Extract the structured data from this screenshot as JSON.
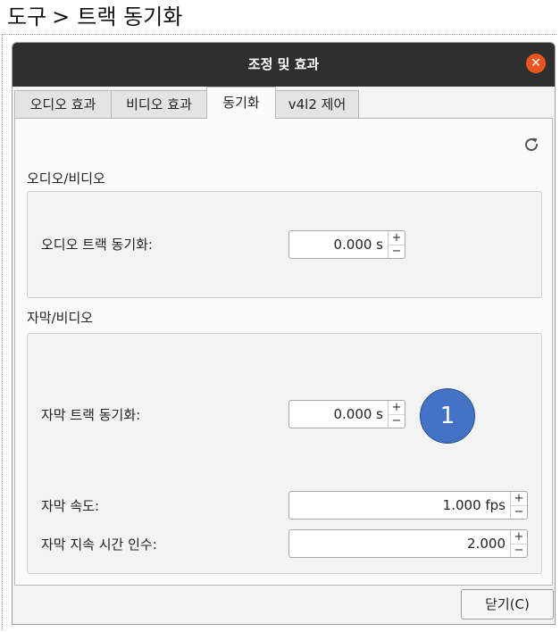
{
  "breadcrumb": {
    "part1": "도구",
    "separator": ">",
    "part2": "트랙 동기화"
  },
  "window": {
    "title": "조정 및 효과",
    "close_icon": "close-icon"
  },
  "tabs": [
    {
      "label": "오디오 효과"
    },
    {
      "label": "비디오 효과"
    },
    {
      "label": "동기화",
      "active": true
    },
    {
      "label": "v4l2 제어"
    }
  ],
  "sync": {
    "refresh_icon": "refresh-icon",
    "audio_video": {
      "section_label": "오디오/비디오",
      "audio_sync_label": "오디오 트랙 동기화:",
      "audio_sync_value": "0.000 s"
    },
    "subtitle_video": {
      "section_label": "자막/비디오",
      "subtitle_sync_label": "자막 트랙 동기화:",
      "subtitle_sync_value": "0.000 s",
      "subtitle_speed_label": "자막 속도:",
      "subtitle_speed_value": "1.000 fps",
      "subtitle_duration_label": "자막 지속 시간 인수:",
      "subtitle_duration_value": "2.000"
    }
  },
  "spin_up": "+",
  "spin_down": "−",
  "marker": {
    "label": "1",
    "color": "#4472c4"
  },
  "footer": {
    "close_button_label": "닫기(C)"
  },
  "colors": {
    "titlebar": "#2f2f2f",
    "close_accent": "#e95420"
  }
}
